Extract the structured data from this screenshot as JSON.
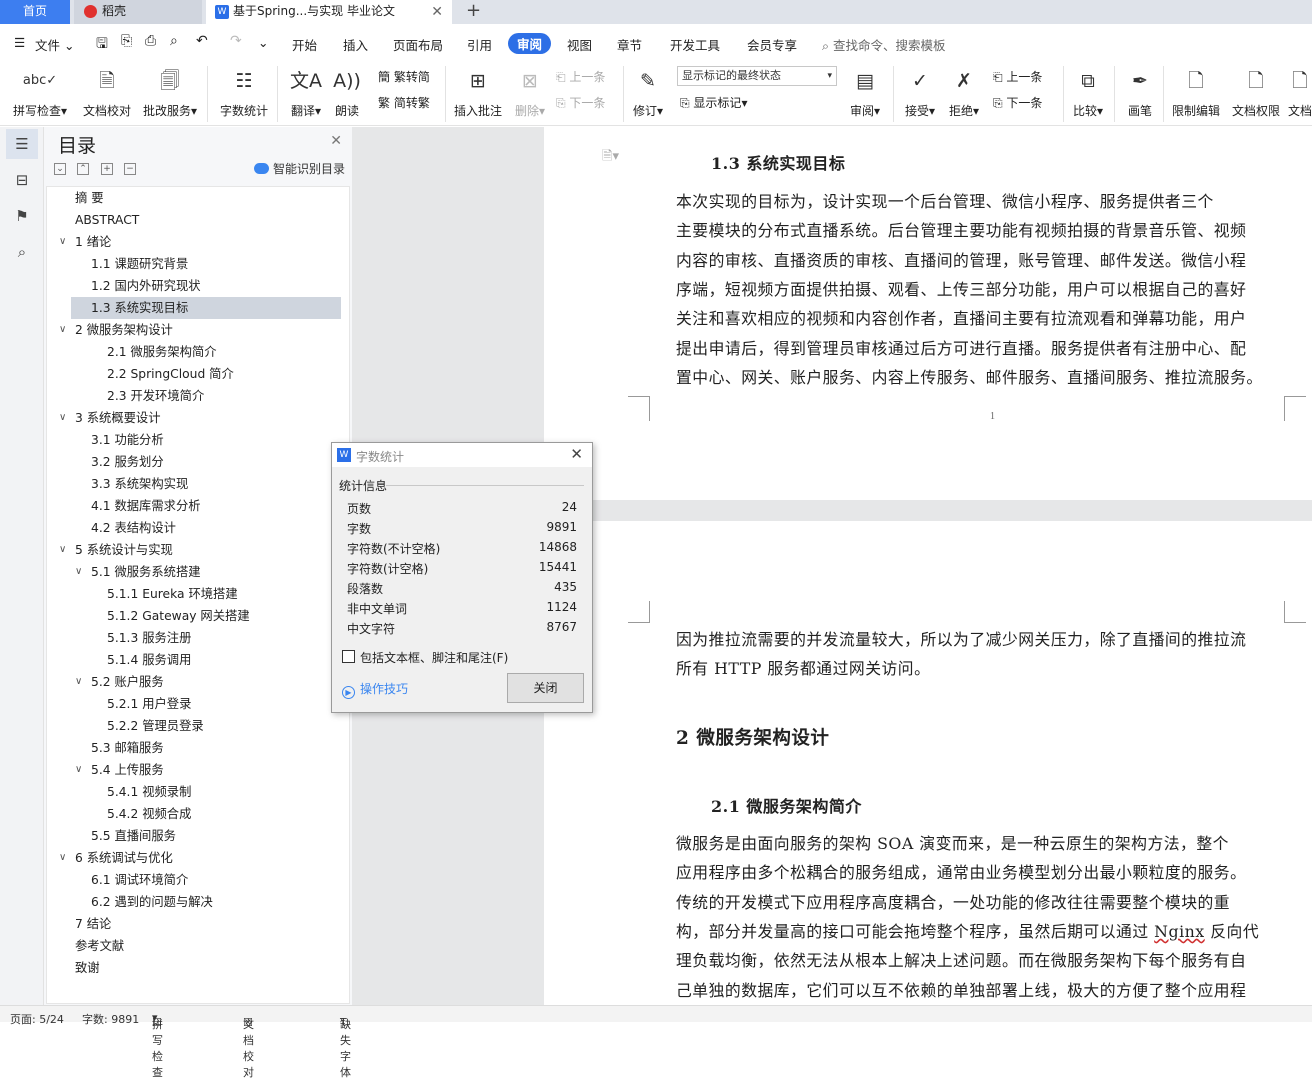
{
  "tabs": {
    "home": "首页",
    "daoke": "稻壳",
    "doc": "基于Spring...与实现 毕业论文",
    "plus": "+"
  },
  "menu": {
    "file": "文件",
    "items": [
      "开始",
      "插入",
      "页面布局",
      "引用",
      "审阅",
      "视图",
      "章节",
      "开发工具",
      "会员专享"
    ],
    "active": "审阅",
    "search_placeholder": "查找命令、搜索模板"
  },
  "ribbon": {
    "spell": "拼写检查",
    "doccheck": "文档校对",
    "batch": "批改服务",
    "wordcount": "字数统计",
    "translate": "翻译",
    "read": "朗读",
    "t2s": "繁转简",
    "s2t": "简转繁",
    "insert_comment": "插入批注",
    "delete": "删除",
    "prev_comment": "上一条",
    "next_comment": "下一条",
    "revise": "修订",
    "markup_state": "显示标记的最终状态",
    "show_markup": "显示标记",
    "review": "审阅",
    "accept": "接受",
    "reject": "拒绝",
    "prev": "上一条",
    "next": "下一条",
    "compare": "比较",
    "pen": "画笔",
    "restrict": "限制编辑",
    "permission": "文档权限",
    "more": "文档"
  },
  "nav": {
    "title": "目录",
    "smart": "智能识别目录",
    "items": [
      {
        "label": "摘  要",
        "level": 0,
        "caret": false
      },
      {
        "label": "ABSTRACT",
        "level": 0,
        "caret": false
      },
      {
        "label": "1  绪论",
        "level": 0,
        "caret": true
      },
      {
        "label": "1.1  课题研究背景",
        "level": 1,
        "caret": false
      },
      {
        "label": "1.2  国内外研究现状",
        "level": 1,
        "caret": false
      },
      {
        "label": "1.3  系统实现目标",
        "level": 1,
        "caret": false,
        "selected": true
      },
      {
        "label": "2  微服务架构设计",
        "level": 0,
        "caret": true
      },
      {
        "label": "2.1  微服务架构简介",
        "level": 2,
        "caret": false
      },
      {
        "label": "2.2 SpringCloud 简介",
        "level": 2,
        "caret": false
      },
      {
        "label": "2.3  开发环境简介",
        "level": 2,
        "caret": false
      },
      {
        "label": "3  系统概要设计",
        "level": 0,
        "caret": true
      },
      {
        "label": "3.1  功能分析",
        "level": 1,
        "caret": false
      },
      {
        "label": "3.2  服务划分",
        "level": 1,
        "caret": false
      },
      {
        "label": "3.3  系统架构实现",
        "level": 1,
        "caret": false
      },
      {
        "label": "4.1  数据库需求分析",
        "level": 1,
        "caret": false
      },
      {
        "label": "4.2  表结构设计",
        "level": 1,
        "caret": false
      },
      {
        "label": "5  系统设计与实现",
        "level": 0,
        "caret": true
      },
      {
        "label": "5.1  微服务系统搭建",
        "level": 1,
        "caret": true
      },
      {
        "label": "5.1.1 Eureka 环境搭建",
        "level": 2,
        "caret": false
      },
      {
        "label": "5.1.2 Gateway 网关搭建",
        "level": 2,
        "caret": false
      },
      {
        "label": "5.1.3  服务注册",
        "level": 2,
        "caret": false
      },
      {
        "label": "5.1.4  服务调用",
        "level": 2,
        "caret": false
      },
      {
        "label": "5.2  账户服务",
        "level": 1,
        "caret": true
      },
      {
        "label": "5.2.1  用户登录",
        "level": 2,
        "caret": false
      },
      {
        "label": "5.2.2  管理员登录",
        "level": 2,
        "caret": false
      },
      {
        "label": "5.3  邮箱服务",
        "level": 1,
        "caret": false
      },
      {
        "label": "5.4  上传服务",
        "level": 1,
        "caret": true
      },
      {
        "label": "5.4.1  视频录制",
        "level": 2,
        "caret": false
      },
      {
        "label": "5.4.2  视频合成",
        "level": 2,
        "caret": false
      },
      {
        "label": "5.5  直播间服务",
        "level": 1,
        "caret": false
      },
      {
        "label": "6  系统调试与优化",
        "level": 0,
        "caret": true
      },
      {
        "label": "6.1  调试环境简介",
        "level": 1,
        "caret": false
      },
      {
        "label": "6.2  遇到的问题与解决",
        "level": 1,
        "caret": false
      },
      {
        "label": "7  结论",
        "level": 0,
        "caret": false
      },
      {
        "label": "参考文献",
        "level": 0,
        "caret": false
      },
      {
        "label": "致谢",
        "level": 0,
        "caret": false
      }
    ]
  },
  "doc": {
    "page1": {
      "heading": "1.3  系统实现目标",
      "lines": [
        "    本次实现的目标为，设计实现一个后台管理、微信小程序、服务提供者三个",
        "主要模块的分布式直播系统。后台管理主要功能有视频拍摄的背景音乐管、视频",
        "内容的审核、直播资质的审核、直播间的管理，账号管理、邮件发送。微信小程",
        "序端，短视频方面提供拍摄、观看、上传三部分功能，用户可以根据自己的喜好",
        "关注和喜欢相应的视频和内容创作者，直播间主要有拉流观看和弹幕功能，用户",
        "提出申请后，得到管理员审核通过后方可进行直播。服务提供者有注册中心、配",
        "置中心、网关、账户服务、内容上传服务、邮件服务、直播间服务、推拉流服务。"
      ],
      "page_number": "1"
    },
    "page2": {
      "lines_top": [
        "因为推拉流需要的并发流量较大，所以为了减少网关压力，除了直播间的推拉流",
        "所有 HTTP 服务都通过网关访问。"
      ],
      "h1": "2  微服务架构设计",
      "h2": "2.1  微服务架构简介",
      "lines": [
        "    微服务是由面向服务的架构 SOA 演变而来，是一种云原生的架构方法，整个",
        "应用程序由多个松耦合的服务组成，通常由业务模型划分出最小颗粒度的服务。",
        "传统的开发模式下应用程序高度耦合，一处功能的修改往往需要整个模块的重",
        "构，部分并发量高的接口可能会拖垮整个程序，虽然后期可以通过 ",
        "理负载均衡，依然无法从根本上解决上述问题。而在微服务架构下每个服务有自",
        "己单独的数据库，它们可以互不依赖的单独部署上线，极大的方便了整个应用程"
      ],
      "nginx_word": "Nginx",
      "nginx_after": " 反向代"
    }
  },
  "dialog": {
    "title": "字数统计",
    "group": "统计信息",
    "stats": [
      {
        "label": "页数",
        "value": "24"
      },
      {
        "label": "字数",
        "value": "9891"
      },
      {
        "label": "字符数(不计空格)",
        "value": "14868"
      },
      {
        "label": "字符数(计空格)",
        "value": "15441"
      },
      {
        "label": "段落数",
        "value": "435"
      },
      {
        "label": "非中文单词",
        "value": "1124"
      },
      {
        "label": "中文字符",
        "value": "8767"
      }
    ],
    "include_label": "包括文本框、脚注和尾注(F)",
    "tips": "操作技巧",
    "close": "关闭"
  },
  "status": {
    "page": "页面: 5/24",
    "words": "字数: 9891",
    "spell": "拼写检查",
    "doccheck": "文档校对",
    "font": "缺失字体"
  }
}
